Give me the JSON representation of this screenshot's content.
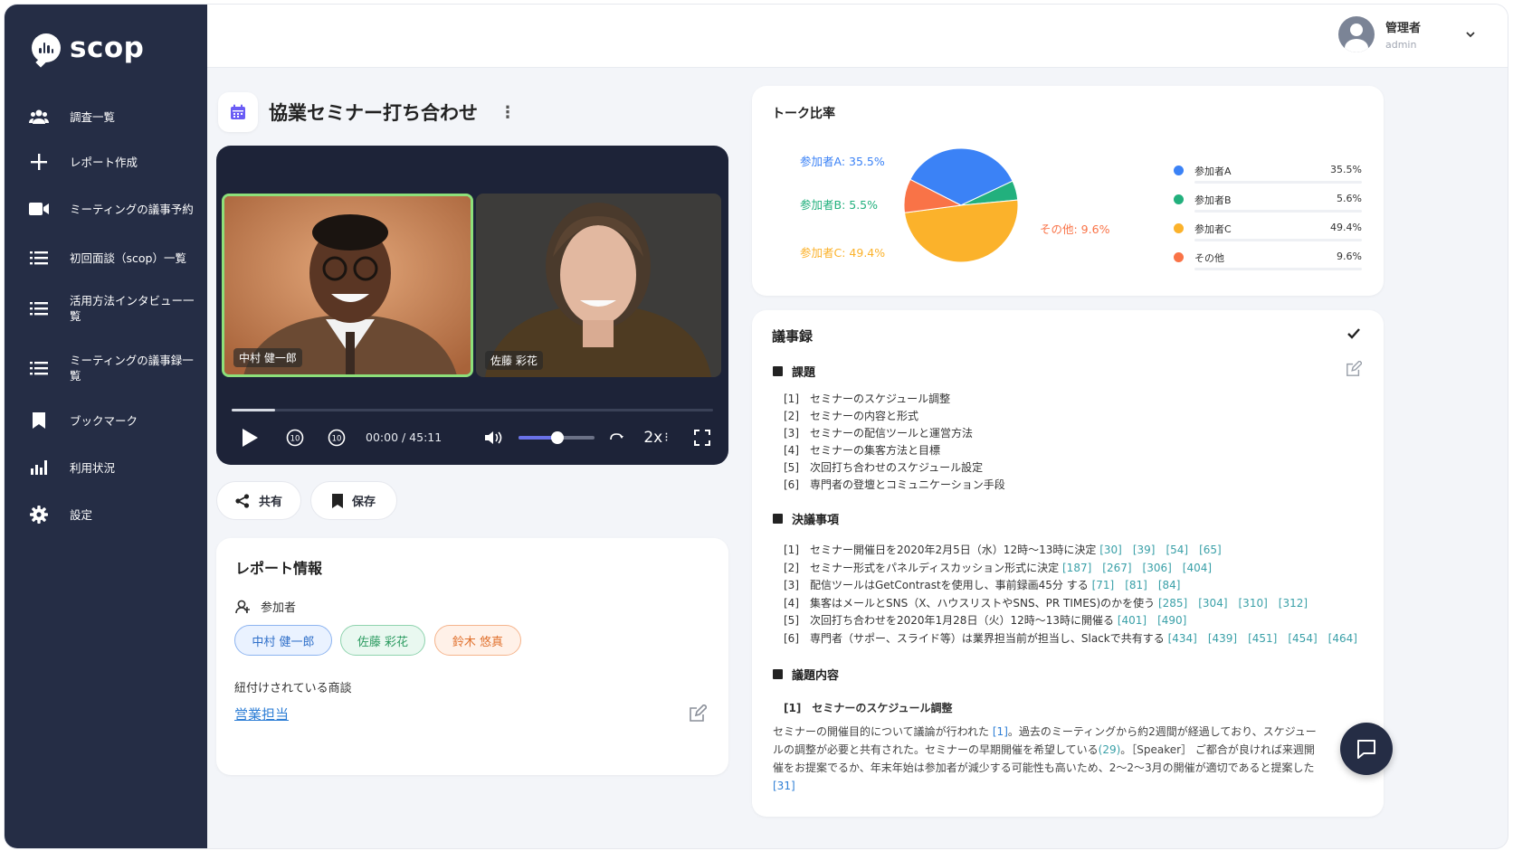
{
  "brand": {
    "name": "scop"
  },
  "sidebar": {
    "items": [
      {
        "label": "調査一覧",
        "icon": "users-icon"
      },
      {
        "label": "レポート作成",
        "icon": "plus-icon"
      },
      {
        "label": "ミーティングの議事予約",
        "icon": "video-camera-icon"
      },
      {
        "label": "初回面談（scop）一覧",
        "icon": "list-icon"
      },
      {
        "label": "活用方法インタビュー一覧",
        "icon": "list-icon"
      },
      {
        "label": "ミーティングの議事録一覧",
        "icon": "list-icon"
      },
      {
        "label": "ブックマーク",
        "icon": "bookmark-icon"
      },
      {
        "label": "利用状況",
        "icon": "bar-chart-icon"
      },
      {
        "label": "設定",
        "icon": "gear-icon"
      }
    ]
  },
  "user": {
    "name": "管理者",
    "role": "admin"
  },
  "page": {
    "title": "協業セミナー打ち合わせ"
  },
  "video": {
    "participants": [
      {
        "name": "中村 健一郎"
      },
      {
        "name": "佐藤 彩花"
      }
    ],
    "time": "00:00 / 45:11",
    "speed": "2x",
    "progress": 0.09,
    "volume": 0.52,
    "rewind_label": "10",
    "forward_label": "10"
  },
  "actions": {
    "share": "共有",
    "save": "保存"
  },
  "report": {
    "title": "レポート情報",
    "participants_label": "参加者",
    "participants": [
      "中村 健一郎",
      "佐藤 彩花",
      "鈴木 悠真"
    ],
    "linked_label": "紐付けされている商談",
    "linked_link": "営業担当"
  },
  "talk": {
    "title": "トーク比率",
    "pie_labels": {
      "a": "参加者A: 35.5%",
      "b": "参加者B: 5.5%",
      "c": "参加者C: 49.4%",
      "other": "その他: 9.6%"
    },
    "legend": [
      {
        "name": "参加者A",
        "value": "35.5%",
        "color": "#3b82f6"
      },
      {
        "name": "参加者B",
        "value": "5.6%",
        "color": "#22b07d"
      },
      {
        "name": "参加者C",
        "value": "49.4%",
        "color": "#fbb22b"
      },
      {
        "name": "その他",
        "value": "9.6%",
        "color": "#f97347"
      }
    ],
    "slices": [
      35.5,
      5.5,
      49.4,
      9.6
    ],
    "colors": {
      "a": "#3b82f6",
      "b": "#22b07d",
      "c": "#fbb22b",
      "other": "#f97347"
    }
  },
  "minutes": {
    "title": "議事録",
    "topics_title": "課題",
    "topics": [
      "[1]　セミナーのスケジュール調整",
      "[2]　セミナーの内容と形式",
      "[3]　セミナーの配信ツールと運営方法",
      "[4]　セミナーの集客方法と目標",
      "[5]　次回打ち合わせのスケジュール設定",
      "[6]　専門者の登壇とコミュニケーション手段"
    ],
    "decisions_title": "決議事項",
    "decisions": [
      {
        "text": "[1]　セミナー開催日を2020年2月5日（水）12時〜13時に決定",
        "refs": "[30]　[39]　[54]　[65]"
      },
      {
        "text": "[2]　セミナー形式をパネルディスカッション形式に決定",
        "refs": "[187]　[267]　[306]　[404]"
      },
      {
        "text": "[3]　配信ツールはGetContrastを使用し、事前録画45分 する",
        "refs": "[71]　[81]　[84]"
      },
      {
        "text": "[4]　集客はメールとSNS（X、ハウスリストやSNS、PR TIMES)のかを使う",
        "refs": "[285]　[304]　[310]　[312]"
      },
      {
        "text": "[5]　次回打ち合わせを2020年1月28日（火）12時〜13時に開催る",
        "refs": "[401]　[490]"
      },
      {
        "text": "[6]　専門者（サポー、スライド等）は業界担当前が担当し、Slackで共有する",
        "refs": "[434]　[439]　[451]　[454]　[464]"
      }
    ],
    "discussion_title": "議題内容",
    "discussion_item": "[1]　セミナーのスケジュール調整",
    "para1": "セミナーの開催目的について議論が行われた",
    "ref1": "[1]",
    "para2": "。過去のミーティングから約2週間が経過しており、スケジュールの調整が必要と共有された。セミナーの早期開催を希望している",
    "ref2": "(29)",
    "para3": "。［Speaker］ ご都合が良ければ来週開催をお提案でるか、年末年始は参加者が減少する可能性も高いため、2〜2〜3月の開催が適切であると提案した",
    "ref3": "[31]"
  }
}
